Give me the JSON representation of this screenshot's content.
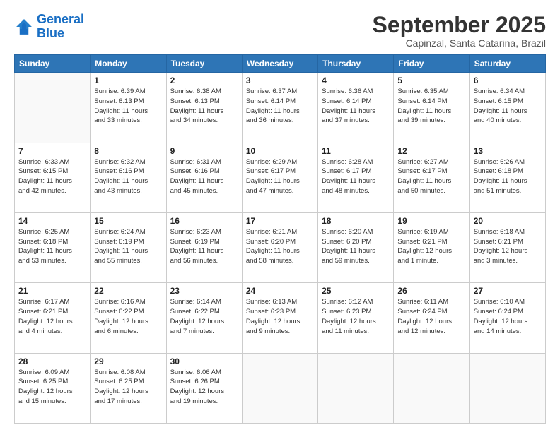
{
  "header": {
    "logo_line1": "General",
    "logo_line2": "Blue",
    "month": "September 2025",
    "location": "Capinzal, Santa Catarina, Brazil"
  },
  "weekdays": [
    "Sunday",
    "Monday",
    "Tuesday",
    "Wednesday",
    "Thursday",
    "Friday",
    "Saturday"
  ],
  "weeks": [
    [
      {
        "day": "",
        "info": ""
      },
      {
        "day": "1",
        "info": "Sunrise: 6:39 AM\nSunset: 6:13 PM\nDaylight: 11 hours\nand 33 minutes."
      },
      {
        "day": "2",
        "info": "Sunrise: 6:38 AM\nSunset: 6:13 PM\nDaylight: 11 hours\nand 34 minutes."
      },
      {
        "day": "3",
        "info": "Sunrise: 6:37 AM\nSunset: 6:14 PM\nDaylight: 11 hours\nand 36 minutes."
      },
      {
        "day": "4",
        "info": "Sunrise: 6:36 AM\nSunset: 6:14 PM\nDaylight: 11 hours\nand 37 minutes."
      },
      {
        "day": "5",
        "info": "Sunrise: 6:35 AM\nSunset: 6:14 PM\nDaylight: 11 hours\nand 39 minutes."
      },
      {
        "day": "6",
        "info": "Sunrise: 6:34 AM\nSunset: 6:15 PM\nDaylight: 11 hours\nand 40 minutes."
      }
    ],
    [
      {
        "day": "7",
        "info": "Sunrise: 6:33 AM\nSunset: 6:15 PM\nDaylight: 11 hours\nand 42 minutes."
      },
      {
        "day": "8",
        "info": "Sunrise: 6:32 AM\nSunset: 6:16 PM\nDaylight: 11 hours\nand 43 minutes."
      },
      {
        "day": "9",
        "info": "Sunrise: 6:31 AM\nSunset: 6:16 PM\nDaylight: 11 hours\nand 45 minutes."
      },
      {
        "day": "10",
        "info": "Sunrise: 6:29 AM\nSunset: 6:17 PM\nDaylight: 11 hours\nand 47 minutes."
      },
      {
        "day": "11",
        "info": "Sunrise: 6:28 AM\nSunset: 6:17 PM\nDaylight: 11 hours\nand 48 minutes."
      },
      {
        "day": "12",
        "info": "Sunrise: 6:27 AM\nSunset: 6:17 PM\nDaylight: 11 hours\nand 50 minutes."
      },
      {
        "day": "13",
        "info": "Sunrise: 6:26 AM\nSunset: 6:18 PM\nDaylight: 11 hours\nand 51 minutes."
      }
    ],
    [
      {
        "day": "14",
        "info": "Sunrise: 6:25 AM\nSunset: 6:18 PM\nDaylight: 11 hours\nand 53 minutes."
      },
      {
        "day": "15",
        "info": "Sunrise: 6:24 AM\nSunset: 6:19 PM\nDaylight: 11 hours\nand 55 minutes."
      },
      {
        "day": "16",
        "info": "Sunrise: 6:23 AM\nSunset: 6:19 PM\nDaylight: 11 hours\nand 56 minutes."
      },
      {
        "day": "17",
        "info": "Sunrise: 6:21 AM\nSunset: 6:20 PM\nDaylight: 11 hours\nand 58 minutes."
      },
      {
        "day": "18",
        "info": "Sunrise: 6:20 AM\nSunset: 6:20 PM\nDaylight: 11 hours\nand 59 minutes."
      },
      {
        "day": "19",
        "info": "Sunrise: 6:19 AM\nSunset: 6:21 PM\nDaylight: 12 hours\nand 1 minute."
      },
      {
        "day": "20",
        "info": "Sunrise: 6:18 AM\nSunset: 6:21 PM\nDaylight: 12 hours\nand 3 minutes."
      }
    ],
    [
      {
        "day": "21",
        "info": "Sunrise: 6:17 AM\nSunset: 6:21 PM\nDaylight: 12 hours\nand 4 minutes."
      },
      {
        "day": "22",
        "info": "Sunrise: 6:16 AM\nSunset: 6:22 PM\nDaylight: 12 hours\nand 6 minutes."
      },
      {
        "day": "23",
        "info": "Sunrise: 6:14 AM\nSunset: 6:22 PM\nDaylight: 12 hours\nand 7 minutes."
      },
      {
        "day": "24",
        "info": "Sunrise: 6:13 AM\nSunset: 6:23 PM\nDaylight: 12 hours\nand 9 minutes."
      },
      {
        "day": "25",
        "info": "Sunrise: 6:12 AM\nSunset: 6:23 PM\nDaylight: 12 hours\nand 11 minutes."
      },
      {
        "day": "26",
        "info": "Sunrise: 6:11 AM\nSunset: 6:24 PM\nDaylight: 12 hours\nand 12 minutes."
      },
      {
        "day": "27",
        "info": "Sunrise: 6:10 AM\nSunset: 6:24 PM\nDaylight: 12 hours\nand 14 minutes."
      }
    ],
    [
      {
        "day": "28",
        "info": "Sunrise: 6:09 AM\nSunset: 6:25 PM\nDaylight: 12 hours\nand 15 minutes."
      },
      {
        "day": "29",
        "info": "Sunrise: 6:08 AM\nSunset: 6:25 PM\nDaylight: 12 hours\nand 17 minutes."
      },
      {
        "day": "30",
        "info": "Sunrise: 6:06 AM\nSunset: 6:26 PM\nDaylight: 12 hours\nand 19 minutes."
      },
      {
        "day": "",
        "info": ""
      },
      {
        "day": "",
        "info": ""
      },
      {
        "day": "",
        "info": ""
      },
      {
        "day": "",
        "info": ""
      }
    ]
  ]
}
